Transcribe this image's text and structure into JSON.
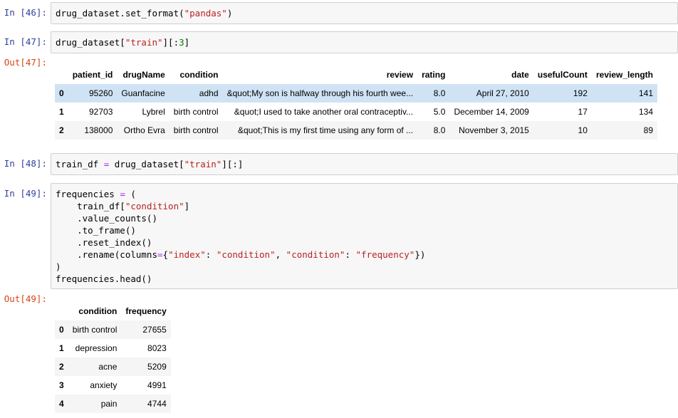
{
  "cells": [
    {
      "in_prompt": "In [46]:",
      "code": [
        [
          [
            "drug_dataset.set_format(",
            ""
          ],
          [
            "\"pandas\"",
            "str"
          ],
          [
            ")",
            ""
          ]
        ]
      ]
    },
    {
      "in_prompt": "In [47]:",
      "code": [
        [
          [
            "drug_dataset[",
            ""
          ],
          [
            "\"train\"",
            "str"
          ],
          [
            "][:",
            ""
          ],
          [
            "3",
            "num"
          ],
          [
            "]",
            ""
          ]
        ]
      ]
    },
    {
      "in_prompt": "In [48]:",
      "code": [
        [
          [
            "train_df ",
            ""
          ],
          [
            "=",
            "op"
          ],
          [
            " drug_dataset[",
            ""
          ],
          [
            "\"train\"",
            "str"
          ],
          [
            "][:]",
            ""
          ]
        ]
      ]
    },
    {
      "in_prompt": "In [49]:",
      "code": [
        [
          [
            "frequencies ",
            ""
          ],
          [
            "=",
            "op"
          ],
          [
            " (",
            ""
          ]
        ],
        [
          [
            "    train_df[",
            ""
          ],
          [
            "\"condition\"",
            "str"
          ],
          [
            "]",
            ""
          ]
        ],
        [
          [
            "    .value_counts()",
            ""
          ]
        ],
        [
          [
            "    .to_frame()",
            ""
          ]
        ],
        [
          [
            "    .reset_index()",
            ""
          ]
        ],
        [
          [
            "    .rename(columns",
            ""
          ],
          [
            "=",
            "op"
          ],
          [
            "{",
            ""
          ],
          [
            "\"index\"",
            "str"
          ],
          [
            ": ",
            ""
          ],
          [
            "\"condition\"",
            "str"
          ],
          [
            ", ",
            ""
          ],
          [
            "\"condition\"",
            "str"
          ],
          [
            ": ",
            ""
          ],
          [
            "\"frequency\"",
            "str"
          ],
          [
            "})",
            ""
          ]
        ],
        [
          [
            ")",
            ""
          ]
        ],
        [
          [
            "frequencies.head()",
            ""
          ]
        ]
      ]
    }
  ],
  "outputs": {
    "out47": {
      "prompt": "Out[47]:",
      "columns": [
        "patient_id",
        "drugName",
        "condition",
        "review",
        "rating",
        "date",
        "usefulCount",
        "review_length"
      ],
      "rows": [
        [
          "0",
          "95260",
          "Guanfacine",
          "adhd",
          "&quot;My son is halfway through his fourth wee...",
          "8.0",
          "April 27, 2010",
          "192",
          "141"
        ],
        [
          "1",
          "92703",
          "Lybrel",
          "birth control",
          "&quot;I used to take another oral contraceptiv...",
          "5.0",
          "December 14, 2009",
          "17",
          "134"
        ],
        [
          "2",
          "138000",
          "Ortho Evra",
          "birth control",
          "&quot;This is my first time using any form of ...",
          "8.0",
          "November 3, 2015",
          "10",
          "89"
        ]
      ]
    },
    "out49": {
      "prompt": "Out[49]:",
      "columns": [
        "condition",
        "frequency"
      ],
      "rows": [
        [
          "0",
          "birth control",
          "27655"
        ],
        [
          "1",
          "depression",
          "8023"
        ],
        [
          "2",
          "acne",
          "5209"
        ],
        [
          "3",
          "anxiety",
          "4991"
        ],
        [
          "4",
          "pain",
          "4744"
        ]
      ]
    }
  }
}
